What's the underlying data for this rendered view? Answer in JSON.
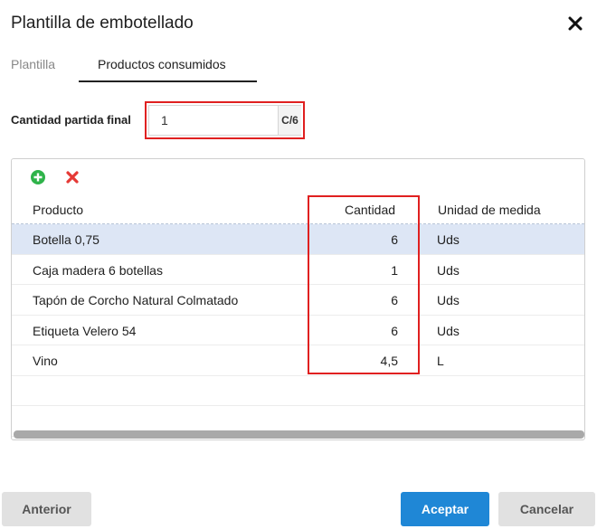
{
  "dialog": {
    "title": "Plantilla de embotellado"
  },
  "tabs": [
    {
      "label": "Plantilla",
      "active": false
    },
    {
      "label": "Productos consumidos",
      "active": true
    }
  ],
  "quantity": {
    "label": "Cantidad partida final",
    "value": "1",
    "unit": "C/6"
  },
  "toolbar": {
    "add_icon": "plus-circle-icon",
    "delete_icon": "x-icon"
  },
  "table": {
    "columns": [
      "Producto",
      "Cantidad",
      "Unidad de medida"
    ],
    "rows": [
      {
        "producto": "Botella 0,75",
        "cantidad": "6",
        "unidad": "Uds",
        "selected": true
      },
      {
        "producto": "Caja madera 6 botellas",
        "cantidad": "1",
        "unidad": "Uds",
        "selected": false
      },
      {
        "producto": "Tapón de Corcho  Natural Colmatado",
        "cantidad": "6",
        "unidad": "Uds",
        "selected": false
      },
      {
        "producto": "Etiqueta Velero 54",
        "cantidad": "6",
        "unidad": "Uds",
        "selected": false
      },
      {
        "producto": "Vino",
        "cantidad": "4,5",
        "unidad": "L",
        "selected": false
      }
    ]
  },
  "buttons": {
    "anterior": "Anterior",
    "aceptar": "Aceptar",
    "cancelar": "Cancelar"
  },
  "colors": {
    "accent": "#1f87d6",
    "highlight": "#e02020",
    "selected_row": "#dde6f5",
    "add_green": "#2fb34a",
    "delete_red": "#e53935"
  }
}
